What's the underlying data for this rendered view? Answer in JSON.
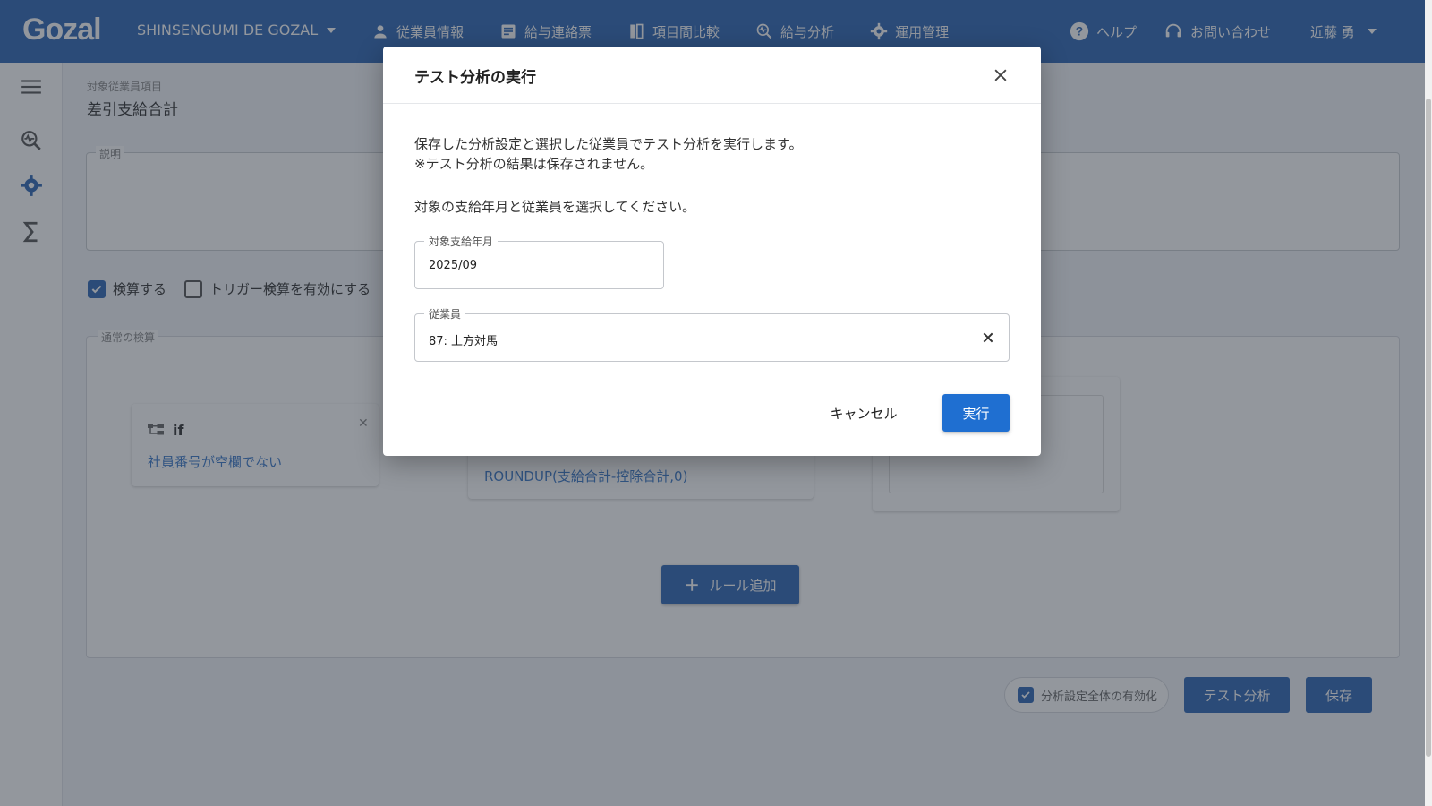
{
  "colors": {
    "header_bg": "#2f67b5",
    "primary": "#1f6fd1",
    "link": "#3a78c9",
    "overlay": "rgba(40,48,60,0.5)"
  },
  "header": {
    "logo": "Gozal",
    "tenant": "SHINSENGUMI DE GOZAL",
    "nav": [
      {
        "label": "従業員情報",
        "icon": "person-icon"
      },
      {
        "label": "給与連絡票",
        "icon": "document-icon"
      },
      {
        "label": "項目間比較",
        "icon": "compare-icon"
      },
      {
        "label": "給与分析",
        "icon": "analysis-icon"
      },
      {
        "label": "運用管理",
        "icon": "gear-icon"
      }
    ],
    "help": "ヘルプ",
    "contact": "お問い合わせ",
    "user": "近藤 勇"
  },
  "sidebar": {
    "items": [
      {
        "icon": "menu-icon"
      },
      {
        "icon": "analysis-icon"
      },
      {
        "icon": "gear-icon"
      },
      {
        "icon": "sigma-icon"
      }
    ]
  },
  "main": {
    "target_caption": "対象従業員項目",
    "target_value": "差引支給合計",
    "description_label": "説明",
    "check_calc": "検算する",
    "check_trigger": "トリガー検算を有効にする",
    "normal_calc_label": "通常の検算",
    "if_title": "if",
    "if_condition": "社員番号が空欄でない",
    "formula": "ROUNDUP(支給合計-控除合計,0)",
    "add_rule": "ルール追加",
    "enable_all": "分析設定全体の有効化",
    "test_button": "テスト分析",
    "save_button": "保存"
  },
  "modal": {
    "title": "テスト分析の実行",
    "desc_line1": "保存した分析設定と選択した従業員でテスト分析を実行します。",
    "desc_line2": "※テスト分析の結果は保存されません。",
    "instruction": "対象の支給年月と従業員を選択してください。",
    "month_label": "対象支給年月",
    "month_value": "2025/09",
    "employee_label": "従業員",
    "employee_value": "87: 土方対馬",
    "cancel": "キャンセル",
    "run": "実行"
  }
}
